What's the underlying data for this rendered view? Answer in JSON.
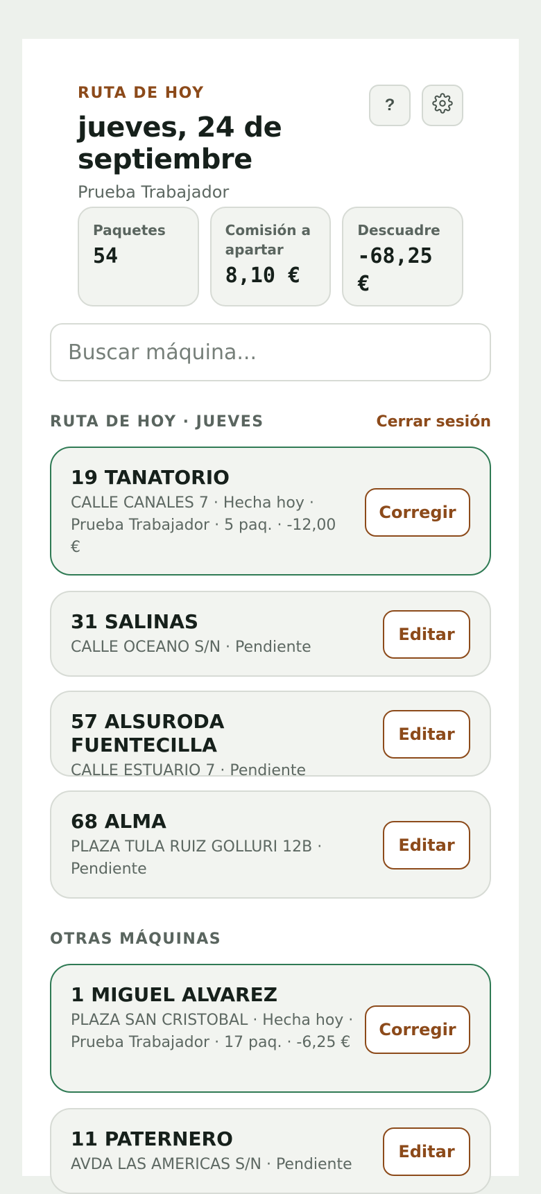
{
  "header": {
    "eyebrow": "RUTA DE HOY",
    "date": "jueves, 24 de septiembre",
    "worker": "Prueba Trabajador",
    "help_label": "?",
    "settings_icon": "gear-icon"
  },
  "stats": [
    {
      "label": "Paquetes",
      "value": "54"
    },
    {
      "label": "Comisión a apartar",
      "value": "8,10 €"
    },
    {
      "label": "Descuadre",
      "value": "-68,25 €"
    }
  ],
  "search": {
    "placeholder": "Buscar máquina..."
  },
  "route_section": {
    "title": "RUTA DE HOY · JUEVES",
    "logout": "Cerrar sesión"
  },
  "route_machines": [
    {
      "title": "19 TANATORIO",
      "subtitle": "CALLE CANALES 7 · Hecha hoy · Prueba Trabajador · 5 paq. · -12,00 €",
      "action": "Corregir"
    },
    {
      "title": "31 SALINAS",
      "subtitle": "CALLE OCEANO S/N · Pendiente",
      "action": "Editar"
    },
    {
      "title": "57 ALSURODA FUENTECILLA",
      "subtitle": "CALLE ESTUARIO 7 · Pendiente",
      "action": "Editar"
    },
    {
      "title": "68 ALMA",
      "subtitle": "PLAZA TULA RUIZ GOLLURI 12B · Pendiente",
      "action": "Editar"
    }
  ],
  "other_section": {
    "title": "OTRAS MÁQUINAS"
  },
  "other_machines": [
    {
      "title": "1 MIGUEL ALVAREZ",
      "subtitle": "PLAZA SAN CRISTOBAL · Hecha hoy · Prueba Trabajador · 17 paq. · -6,25 €",
      "action": "Corregir"
    },
    {
      "title": "11 PATERNERO",
      "subtitle": "AVDA LAS AMERICAS S/N · Pendiente",
      "action": "Editar"
    }
  ],
  "colors": {
    "accent": "#8c4a1a",
    "done_border": "#2f7a54",
    "background": "#edf1ec"
  }
}
